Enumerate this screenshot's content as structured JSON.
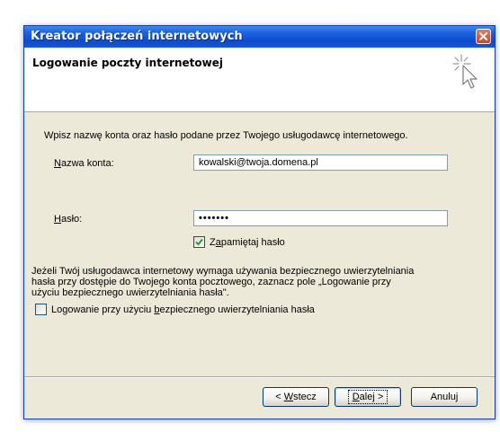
{
  "window": {
    "title": "Kreator połączeń internetowych"
  },
  "header": {
    "title": "Logowanie poczty internetowej",
    "icon": "wizard-cursor-icon"
  },
  "intro_text": "Wpisz nazwę konta oraz hasło podane przez Twojego usługodawcę internetowego.",
  "account": {
    "label_accel": "N",
    "label_rest": "azwa konta:",
    "value": "kowalski@twoja.domena.pl"
  },
  "password": {
    "label_accel": "H",
    "label_rest": "asło:",
    "value": "•••••••"
  },
  "remember": {
    "checked": true,
    "label_pre": "Z",
    "label_accel": "a",
    "label_rest": "pamiętaj hasło"
  },
  "note": {
    "line1": "Jeżeli Twój usługodawca internetowy wymaga używania bezpiecznego uwierzytelniania",
    "line2": "hasła przy dostępie do Twojego konta pocztowego, zaznacz pole „Logowanie przy",
    "line3": "użyciu bezpiecznego uwierzytelniania hasła\"."
  },
  "spa": {
    "checked": false,
    "label_pre": "Logowanie przy użyciu ",
    "label_accel": "b",
    "label_rest": "ezpiecznego uwierzytelniania hasła"
  },
  "buttons": {
    "back_pre": "< ",
    "back_accel": "W",
    "back_rest": "stecz",
    "next_accel": "D",
    "next_rest": "alej >",
    "cancel": "Anuluj"
  },
  "colors": {
    "title_bar": "#0b4bcf",
    "dialog_bg": "#ece9d8",
    "close_button": "#d2441b",
    "check_mark": "#21a121"
  }
}
